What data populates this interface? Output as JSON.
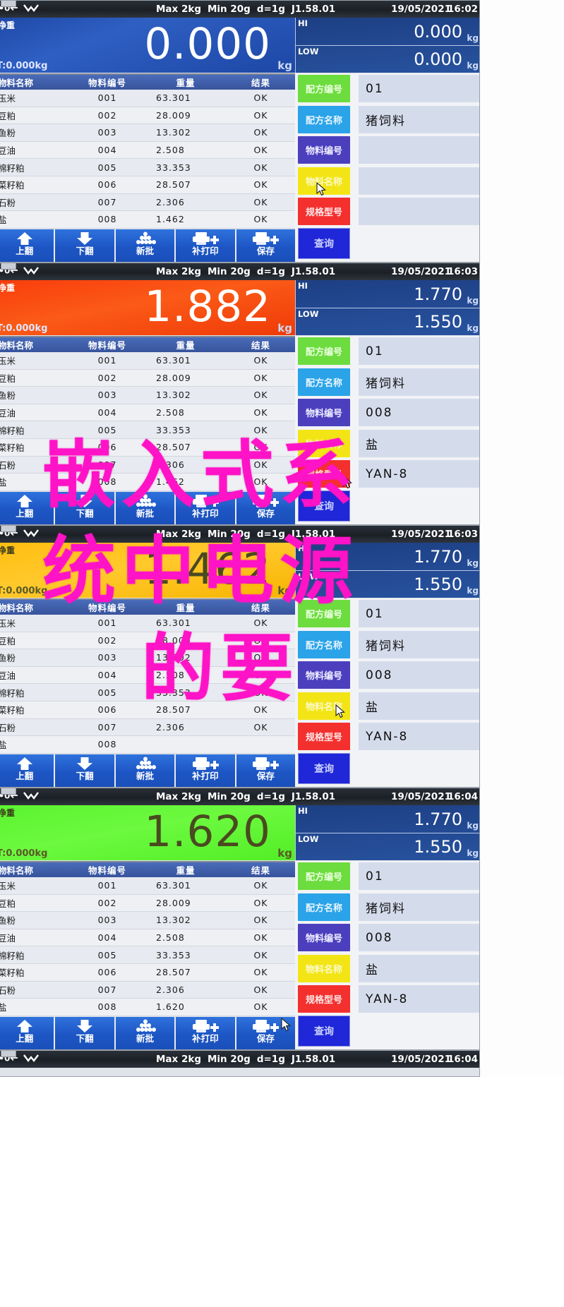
{
  "device": {
    "spec": {
      "max": "Max 2kg",
      "min": "Min 20g",
      "division": "d=1g",
      "version": "J1.58.01"
    },
    "unit": "kg",
    "net_label": "净重",
    "tare_label": "T:0.000kg",
    "hi_label": "HI",
    "low_label": "LOW"
  },
  "table": {
    "headers": {
      "name": "物料名称",
      "code": "物料编号",
      "weight": "重量",
      "result": "结果"
    }
  },
  "field_labels": {
    "formula_code": "配方编号",
    "formula_name": "配方名称",
    "material_code": "物料编号",
    "material_name": "物料名称",
    "spec_model": "规格型号",
    "query": "查询"
  },
  "toolbar": {
    "page_up": "上翻",
    "page_down": "下翻",
    "new_batch": "新批",
    "reprint": "补打印",
    "save": "保存"
  },
  "icons": {
    "zero": "0",
    "tare_arrow": "←",
    "stable": "stable-icon",
    "up_arrow": "up-arrow-icon",
    "down_arrow": "down-arrow-icon",
    "batch": "batch-stack-icon",
    "printer_plus": "printer-plus-icon",
    "cursor": "mouse-pointer-icon"
  },
  "colors": {
    "formula_code": "#6ddc3e",
    "formula_name": "#2aa3e8",
    "material_code": "#4b3fbe",
    "material_name": "#f3e515",
    "spec_model": "#f4302f",
    "query": "#1f27d8",
    "weight_normal": "#2e5fc2",
    "weight_over": "#fb5a17",
    "weight_near": "#ffc92c",
    "weight_ok": "#6cf93f"
  },
  "panels": [
    {
      "date": "19/05/2021",
      "time": "16:02",
      "weight": "0.000",
      "weight_state": "blue",
      "hi": "0.000",
      "low": "0.000",
      "rows": [
        {
          "name": "玉米",
          "code": "001",
          "weight": "63.301",
          "result": "OK"
        },
        {
          "name": "豆粕",
          "code": "002",
          "weight": "28.009",
          "result": "OK"
        },
        {
          "name": "鱼粉",
          "code": "003",
          "weight": "13.302",
          "result": "OK"
        },
        {
          "name": "豆油",
          "code": "004",
          "weight": "2.508",
          "result": "OK"
        },
        {
          "name": "棉籽粕",
          "code": "005",
          "weight": "33.353",
          "result": "OK"
        },
        {
          "name": "菜籽粕",
          "code": "006",
          "weight": "28.507",
          "result": "OK"
        },
        {
          "name": "石粉",
          "code": "007",
          "weight": "2.306",
          "result": "OK"
        },
        {
          "name": "盐",
          "code": "008",
          "weight": "1.462",
          "result": "OK"
        }
      ],
      "fields": {
        "formula_code": "01",
        "formula_name": "猪饲料",
        "material_code": "",
        "material_name": "",
        "spec_model": ""
      }
    },
    {
      "date": "19/05/2021",
      "time": "16:03",
      "weight": "1.882",
      "weight_state": "red",
      "hi": "1.770",
      "low": "1.550",
      "rows": [
        {
          "name": "玉米",
          "code": "001",
          "weight": "63.301",
          "result": "OK"
        },
        {
          "name": "豆粕",
          "code": "002",
          "weight": "28.009",
          "result": "OK"
        },
        {
          "name": "鱼粉",
          "code": "003",
          "weight": "13.302",
          "result": "OK"
        },
        {
          "name": "豆油",
          "code": "004",
          "weight": "2.508",
          "result": "OK"
        },
        {
          "name": "棉籽粕",
          "code": "005",
          "weight": "33.353",
          "result": "OK"
        },
        {
          "name": "菜籽粕",
          "code": "006",
          "weight": "28.507",
          "result": "OK"
        },
        {
          "name": "石粉",
          "code": "007",
          "weight": "2.306",
          "result": "OK"
        },
        {
          "name": "盐",
          "code": "008",
          "weight": "1.462",
          "result": "OK"
        }
      ],
      "fields": {
        "formula_code": "01",
        "formula_name": "猪饲料",
        "material_code": "008",
        "material_name": "盐",
        "spec_model": "YAN-8"
      }
    },
    {
      "date": "19/05/2021",
      "time": "16:03",
      "weight": "1.462",
      "weight_state": "amber",
      "hi": "1.770",
      "low": "1.550",
      "rows": [
        {
          "name": "玉米",
          "code": "001",
          "weight": "63.301",
          "result": "OK"
        },
        {
          "name": "豆粕",
          "code": "002",
          "weight": "28.009",
          "result": "OK"
        },
        {
          "name": "鱼粉",
          "code": "003",
          "weight": "13.302",
          "result": "OK"
        },
        {
          "name": "豆油",
          "code": "004",
          "weight": "2.508",
          "result": "OK"
        },
        {
          "name": "棉籽粕",
          "code": "005",
          "weight": "33.353",
          "result": "OK"
        },
        {
          "name": "菜籽粕",
          "code": "006",
          "weight": "28.507",
          "result": "OK"
        },
        {
          "name": "石粉",
          "code": "007",
          "weight": "2.306",
          "result": "OK"
        },
        {
          "name": "盐",
          "code": "008",
          "weight": "",
          "result": ""
        }
      ],
      "fields": {
        "formula_code": "01",
        "formula_name": "猪饲料",
        "material_code": "008",
        "material_name": "盐",
        "spec_model": "YAN-8"
      }
    },
    {
      "date": "19/05/2021",
      "time": "16:04",
      "weight": "1.620",
      "weight_state": "green",
      "hi": "1.770",
      "low": "1.550",
      "rows": [
        {
          "name": "玉米",
          "code": "001",
          "weight": "63.301",
          "result": "OK"
        },
        {
          "name": "豆粕",
          "code": "002",
          "weight": "28.009",
          "result": "OK"
        },
        {
          "name": "鱼粉",
          "code": "003",
          "weight": "13.302",
          "result": "OK"
        },
        {
          "name": "豆油",
          "code": "004",
          "weight": "2.508",
          "result": "OK"
        },
        {
          "name": "棉籽粕",
          "code": "005",
          "weight": "33.353",
          "result": "OK"
        },
        {
          "name": "菜籽粕",
          "code": "006",
          "weight": "28.507",
          "result": "OK"
        },
        {
          "name": "石粉",
          "code": "007",
          "weight": "2.306",
          "result": "OK"
        },
        {
          "name": "盐",
          "code": "008",
          "weight": "1.620",
          "result": "OK"
        }
      ],
      "fields": {
        "formula_code": "01",
        "formula_name": "猪饲料",
        "material_code": "008",
        "material_name": "盐",
        "spec_model": "YAN-8"
      }
    },
    {
      "date": "19/05/2021",
      "time": "16:04",
      "weight": "",
      "weight_state": "blue",
      "hi": "",
      "low": "",
      "rows": [],
      "fields": {
        "formula_code": "",
        "formula_name": "",
        "material_code": "",
        "material_name": "",
        "spec_model": ""
      }
    }
  ],
  "watermark": {
    "line1": "嵌入式系",
    "line2": "统中电源",
    "line3": "的要"
  }
}
